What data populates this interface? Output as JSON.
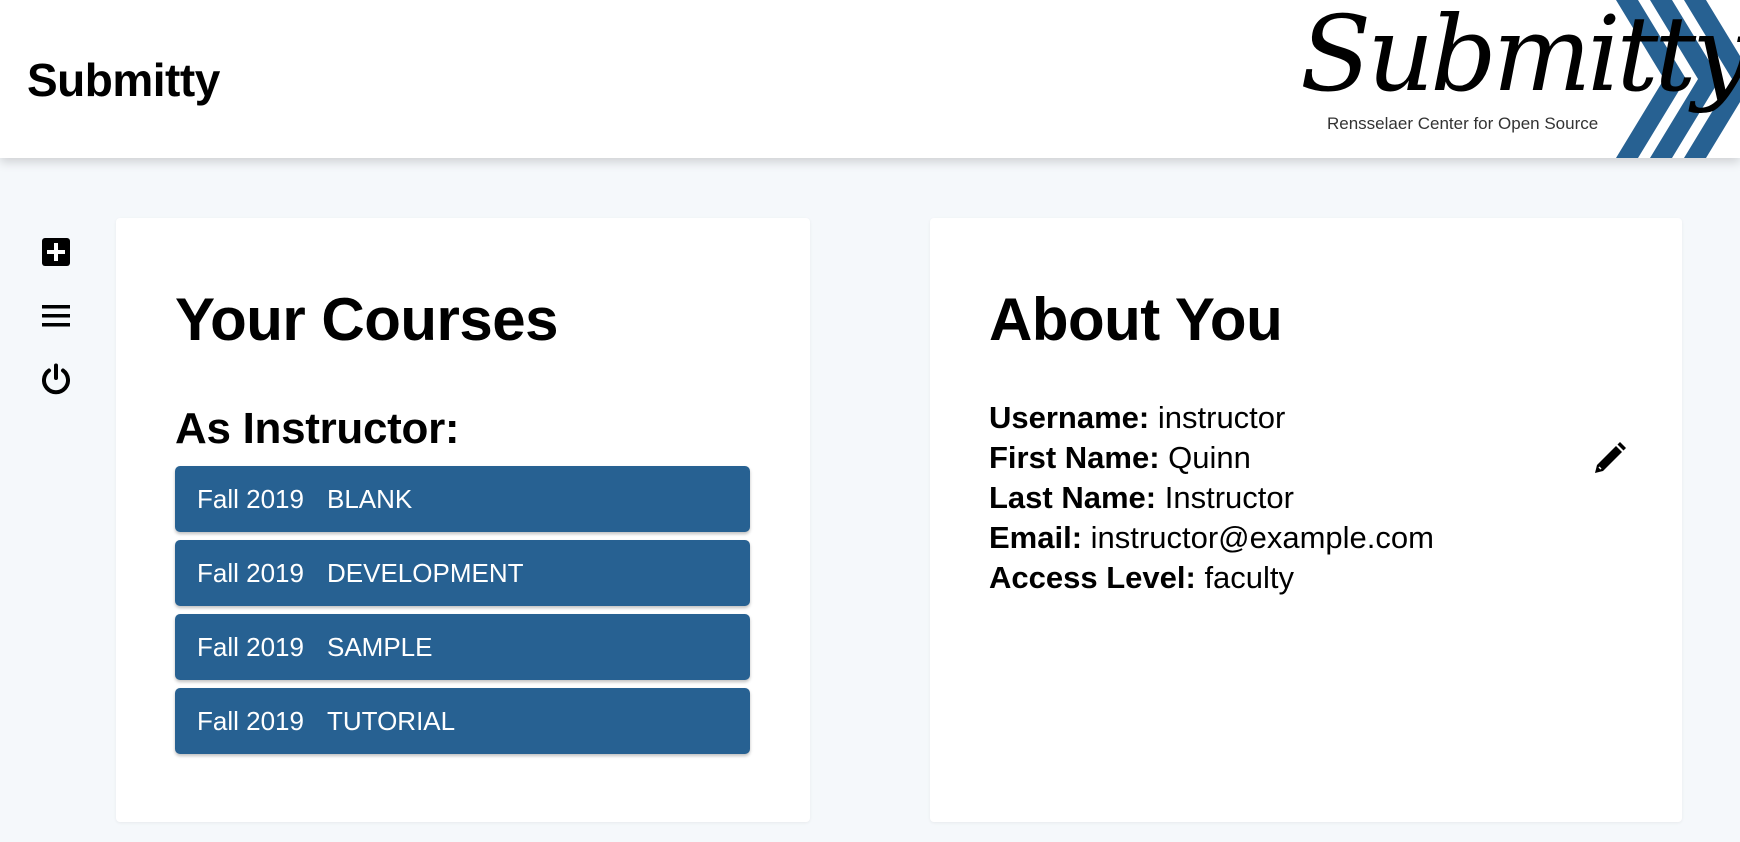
{
  "header": {
    "site_title": "Submitty",
    "logo_wordmark": "Submitty",
    "logo_subtitle": "Rensselaer Center for Open Source",
    "brand_color": "#276192"
  },
  "sidebar": {
    "items": [
      {
        "icon": "plus-square-icon",
        "label": "New Course"
      },
      {
        "icon": "menu-icon",
        "label": "Menu"
      },
      {
        "icon": "power-icon",
        "label": "Logout"
      }
    ]
  },
  "courses": {
    "title": "Your Courses",
    "section_title": "As Instructor:",
    "items": [
      {
        "term": "Fall 2019",
        "name": "BLANK"
      },
      {
        "term": "Fall 2019",
        "name": "DEVELOPMENT"
      },
      {
        "term": "Fall 2019",
        "name": "SAMPLE"
      },
      {
        "term": "Fall 2019",
        "name": "TUTORIAL"
      }
    ]
  },
  "about": {
    "title": "About You",
    "fields": [
      {
        "label": "Username:",
        "value": "instructor"
      },
      {
        "label": "First Name:",
        "value": "Quinn"
      },
      {
        "label": "Last Name:",
        "value": "Instructor"
      },
      {
        "label": "Email:",
        "value": "instructor@example.com"
      },
      {
        "label": "Access Level:",
        "value": "faculty"
      }
    ],
    "edit_icon": "pencil-icon"
  }
}
